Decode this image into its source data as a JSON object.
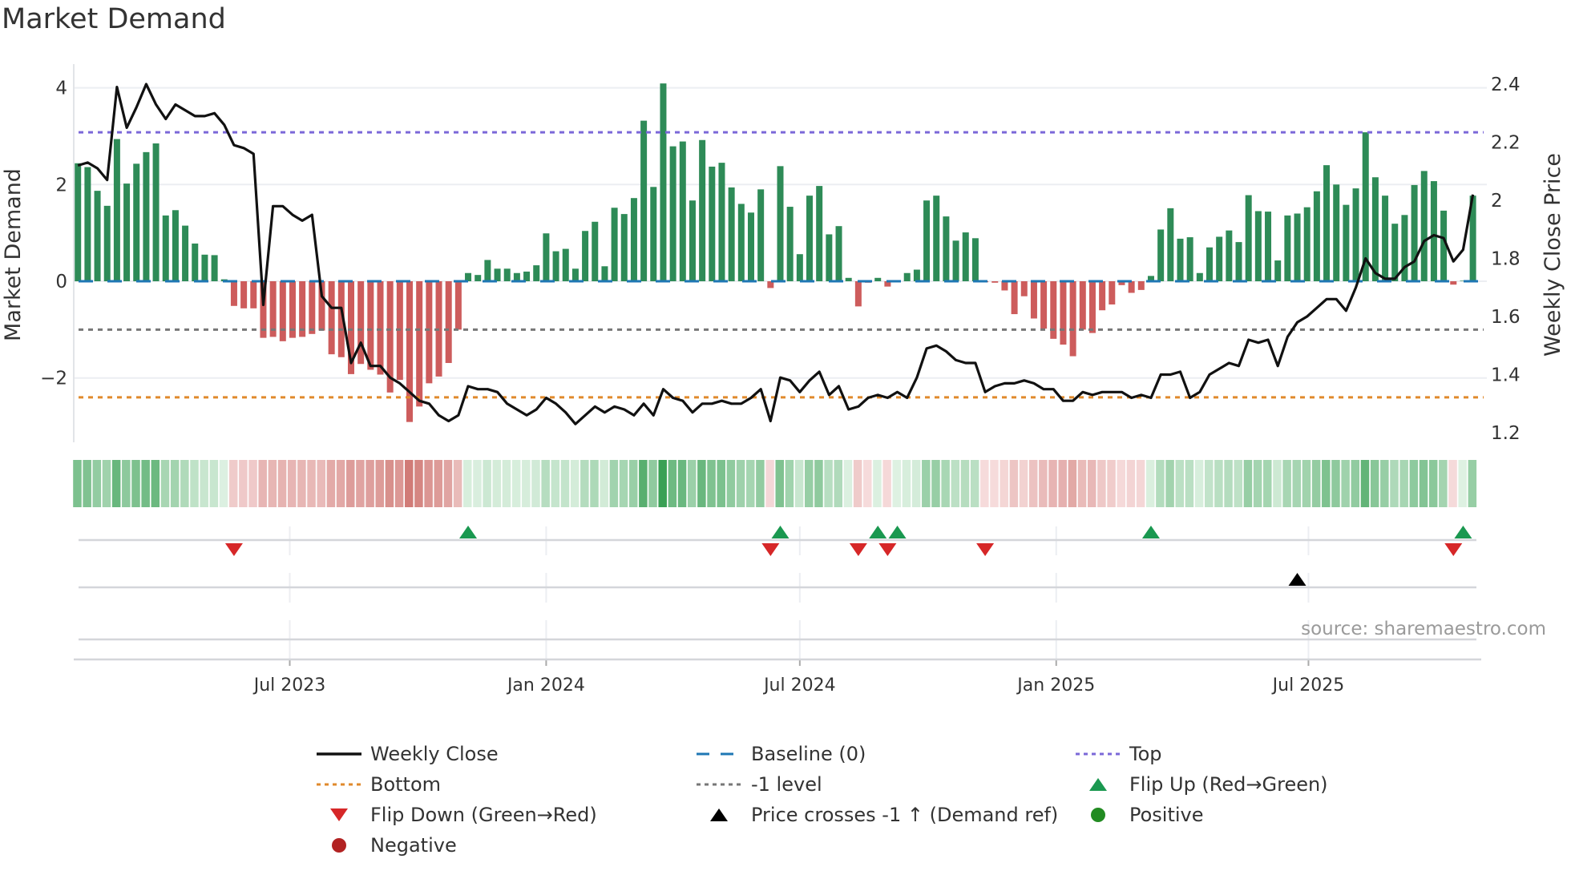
{
  "title": "Market Demand",
  "source": "source: sharemaestro.com",
  "chart_data": {
    "type": "bar",
    "title": "Market Demand",
    "x_start": "2023-01-30",
    "x_step_days": 7,
    "xlim": [
      "2023-01-27",
      "2025-11-06"
    ],
    "x_ticks": [
      {
        "date": "2023-07-01",
        "label": "Jul 2023"
      },
      {
        "date": "2024-01-01",
        "label": "Jan 2024"
      },
      {
        "date": "2024-07-01",
        "label": "Jul 2024"
      },
      {
        "date": "2025-01-01",
        "label": "Jan 2025"
      },
      {
        "date": "2025-07-01",
        "label": "Jul 2025"
      }
    ],
    "left_axis": {
      "label": "Market Demand",
      "range": [
        -3.33,
        4.49
      ],
      "ticks": [
        4,
        2,
        0,
        -2
      ],
      "tick_labels": [
        "4",
        "2",
        "0",
        "−2"
      ]
    },
    "right_axis": {
      "label": "Weekly Close Price",
      "range": [
        1.167,
        2.469
      ],
      "ticks": [
        2.4,
        2.2,
        2.0,
        1.8,
        1.6,
        1.4,
        1.2
      ],
      "tick_labels": [
        "2.4",
        "2.2",
        "2",
        "1.8",
        "1.6",
        "1.4",
        "1.2"
      ]
    },
    "levels": {
      "top": 3.08,
      "baseline": 0,
      "minus_one": -1,
      "bottom": -2.4
    },
    "demand": [
      2.44,
      2.36,
      1.87,
      1.56,
      2.94,
      2.02,
      2.43,
      2.67,
      2.85,
      1.36,
      1.47,
      1.15,
      0.78,
      0.55,
      0.54,
      0.04,
      -0.51,
      -0.56,
      -0.56,
      -1.17,
      -1.15,
      -1.24,
      -1.17,
      -1.15,
      -1.09,
      -1.02,
      -1.51,
      -1.57,
      -1.92,
      -1.71,
      -1.83,
      -1.93,
      -2.3,
      -2.04,
      -2.91,
      -2.59,
      -2.11,
      -1.97,
      -1.69,
      -1.0,
      0.17,
      0.13,
      0.44,
      0.26,
      0.26,
      0.17,
      0.2,
      0.33,
      0.99,
      0.62,
      0.67,
      0.26,
      1.04,
      1.23,
      0.31,
      1.52,
      1.39,
      1.72,
      3.32,
      1.95,
      4.09,
      2.79,
      2.89,
      1.67,
      2.92,
      2.37,
      2.45,
      1.94,
      1.6,
      1.42,
      1.9,
      -0.14,
      2.38,
      1.54,
      0.56,
      1.77,
      1.97,
      0.97,
      1.14,
      0.07,
      -0.52,
      -0.03,
      0.07,
      -0.11,
      0.01,
      0.17,
      0.24,
      1.67,
      1.77,
      1.34,
      0.84,
      1.01,
      0.89,
      -0.02,
      -0.03,
      -0.19,
      -0.68,
      -0.31,
      -0.77,
      -0.98,
      -1.19,
      -1.31,
      -1.55,
      -1.0,
      -1.07,
      -0.6,
      -0.48,
      -0.08,
      -0.24,
      -0.18,
      0.11,
      1.07,
      1.51,
      0.88,
      0.91,
      0.17,
      0.7,
      0.92,
      1.05,
      0.81,
      1.78,
      1.45,
      1.44,
      0.43,
      1.36,
      1.4,
      1.53,
      1.86,
      2.4,
      2.0,
      1.58,
      1.92,
      3.08,
      2.15,
      1.77,
      1.19,
      1.37,
      1.99,
      2.28,
      2.07,
      1.46,
      -0.07,
      0.01,
      1.77
    ],
    "weekly_close": [
      2.12,
      2.13,
      2.11,
      2.07,
      2.39,
      2.25,
      2.32,
      2.4,
      2.33,
      2.28,
      2.33,
      2.31,
      2.29,
      2.29,
      2.3,
      2.26,
      2.19,
      2.18,
      2.16,
      1.64,
      1.98,
      1.98,
      1.95,
      1.93,
      1.95,
      1.67,
      1.63,
      1.63,
      1.44,
      1.51,
      1.43,
      1.43,
      1.39,
      1.37,
      1.34,
      1.31,
      1.3,
      1.26,
      1.24,
      1.26,
      1.36,
      1.35,
      1.35,
      1.34,
      1.3,
      1.28,
      1.26,
      1.28,
      1.32,
      1.3,
      1.27,
      1.23,
      1.26,
      1.29,
      1.27,
      1.29,
      1.28,
      1.26,
      1.3,
      1.26,
      1.35,
      1.32,
      1.31,
      1.27,
      1.3,
      1.3,
      1.31,
      1.3,
      1.3,
      1.32,
      1.35,
      1.24,
      1.39,
      1.38,
      1.34,
      1.38,
      1.41,
      1.33,
      1.36,
      1.28,
      1.29,
      1.32,
      1.33,
      1.32,
      1.34,
      1.32,
      1.39,
      1.49,
      1.5,
      1.48,
      1.45,
      1.44,
      1.44,
      1.34,
      1.36,
      1.37,
      1.37,
      1.38,
      1.37,
      1.35,
      1.35,
      1.31,
      1.31,
      1.34,
      1.33,
      1.34,
      1.34,
      1.34,
      1.32,
      1.33,
      1.32,
      1.4,
      1.4,
      1.41,
      1.32,
      1.34,
      1.4,
      1.42,
      1.44,
      1.43,
      1.52,
      1.51,
      1.52,
      1.43,
      1.53,
      1.58,
      1.6,
      1.63,
      1.66,
      1.66,
      1.62,
      1.7,
      1.8,
      1.75,
      1.73,
      1.73,
      1.77,
      1.79,
      1.86,
      1.88,
      1.87,
      1.79,
      1.83,
      2.02
    ],
    "flip_up_idx": [
      40,
      72,
      82,
      84,
      110,
      142
    ],
    "flip_down_idx": [
      16,
      71,
      80,
      83,
      93,
      141
    ],
    "price_cross_idx": [
      125
    ],
    "legend_placement": "bottom",
    "legend": [
      {
        "label": "Weekly Close",
        "symbol": "line-solid",
        "color": "#111111"
      },
      {
        "label": "Baseline (0)",
        "symbol": "line-dashed",
        "color": "#1f77b4"
      },
      {
        "label": "Top",
        "symbol": "line-dotted",
        "color": "#7b68d8"
      },
      {
        "label": "Bottom",
        "symbol": "line-dotted",
        "color": "#e08a2c"
      },
      {
        "label": "-1 level",
        "symbol": "line-dotted",
        "color": "#777777"
      },
      {
        "label": "Flip Up (Red→Green)",
        "symbol": "triangle-up",
        "color": "#1a9850"
      },
      {
        "label": "Flip Down (Green→Red)",
        "symbol": "triangle-down",
        "color": "#d62728"
      },
      {
        "label": "Price crosses -1 ↑ (Demand ref)",
        "symbol": "triangle-up",
        "color": "#000000"
      },
      {
        "label": "Positive",
        "symbol": "circle",
        "color": "#228b22"
      },
      {
        "label": "Negative",
        "symbol": "circle",
        "color": "#b22222"
      }
    ],
    "colors": {
      "positive_bar": "#2e8b57",
      "negative_bar": "#cd5c5c",
      "price_line": "#111111",
      "grid": "#eceef2"
    }
  }
}
